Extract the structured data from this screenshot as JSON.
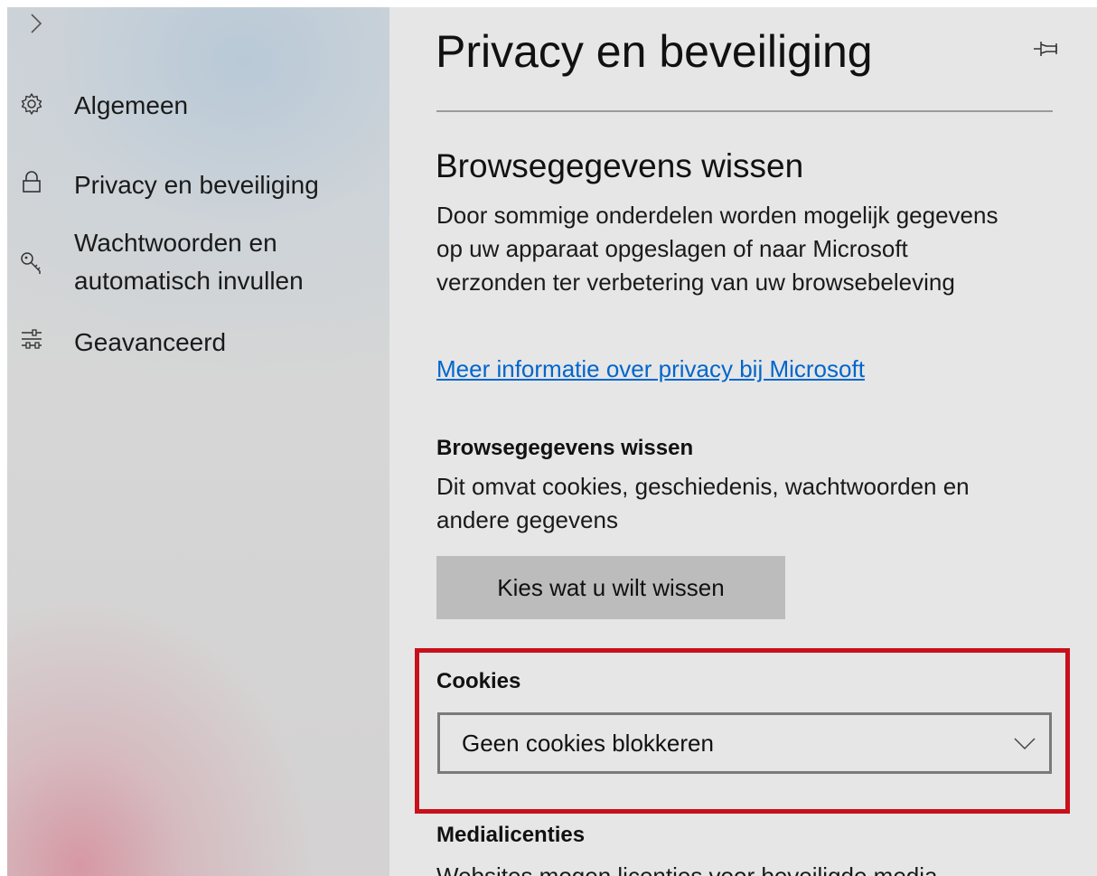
{
  "sidebar": {
    "expand_icon": "chevron-right-icon",
    "items": [
      {
        "label": "Algemeen",
        "icon": "gear-icon"
      },
      {
        "label": "Privacy en beveiliging",
        "icon": "lock-icon"
      },
      {
        "label_line1": "Wachtwoorden en",
        "label_line2": "automatisch invullen",
        "icon": "key-icon"
      },
      {
        "label": "Geavanceerd",
        "icon": "sliders-icon"
      }
    ]
  },
  "main": {
    "title": "Privacy en beveiliging",
    "pin_icon": "pin-icon",
    "section_title": "Browsegegevens wissen",
    "section_description": "Door sommige onderdelen worden mogelijk gegevens op uw apparaat opgeslagen of naar Microsoft verzonden ter verbetering van uw browsebeleving",
    "privacy_link": "Meer informatie over privacy bij Microsoft",
    "clear_data": {
      "heading": "Browsegegevens wissen",
      "description": "Dit omvat cookies, geschiedenis, wachtwoorden en andere gegevens",
      "button_label": "Kies wat u wilt wissen"
    },
    "cookies": {
      "heading": "Cookies",
      "selected_value": "Geen cookies blokkeren"
    },
    "media_licenses": {
      "heading": "Medialicenties",
      "description_partial": "Websites mogen licenties voor beveiligde media"
    }
  },
  "colors": {
    "accent_link": "#0066cc",
    "highlight_border": "#c8101b",
    "panel_background": "#e6e6e6",
    "button_background": "#bcbcbc"
  }
}
